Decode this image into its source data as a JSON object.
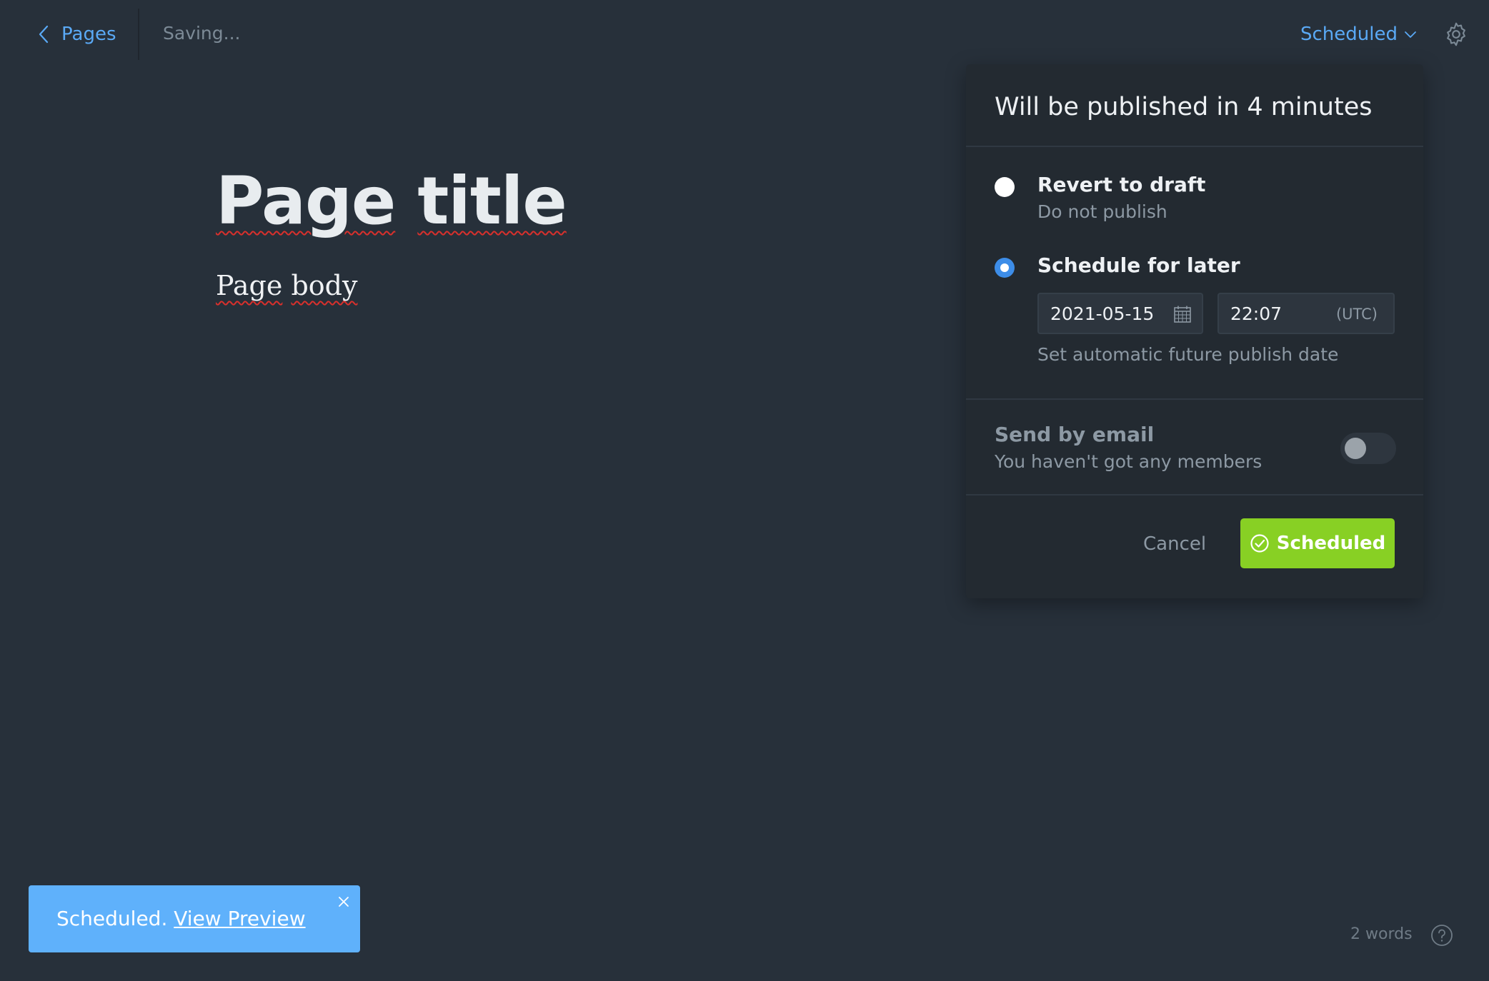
{
  "header": {
    "back_label": "Pages",
    "saving_status": "Saving...",
    "status_dropdown_label": "Scheduled"
  },
  "editor": {
    "title_words": [
      "Page",
      "title"
    ],
    "body_words": [
      "Page",
      "body"
    ]
  },
  "publish_panel": {
    "title": "Will be published in 4 minutes",
    "revert_option": {
      "label": "Revert to draft",
      "sublabel": "Do not publish",
      "selected": false
    },
    "schedule_option": {
      "label": "Schedule for later",
      "selected": true,
      "date_value": "2021-05-15",
      "time_value": "22:07",
      "timezone": "(UTC)",
      "helper": "Set automatic future publish date"
    },
    "email": {
      "label": "Send by email",
      "sublabel": "You haven't got any members",
      "enabled": false
    },
    "cancel_label": "Cancel",
    "confirm_label": "Scheduled"
  },
  "toast": {
    "message": "Scheduled.",
    "link_label": "View Preview"
  },
  "footer": {
    "word_count": "2 words"
  },
  "colors": {
    "background": "#27303a",
    "panel": "#232a31",
    "accent_blue": "#5aa9f5",
    "success_green": "#88d024",
    "toast_blue": "#5fb1fb"
  },
  "icons": [
    "chevron-left-icon",
    "chevron-down-icon",
    "gear-icon",
    "calendar-icon",
    "check-circle-icon",
    "close-icon",
    "help-icon"
  ]
}
